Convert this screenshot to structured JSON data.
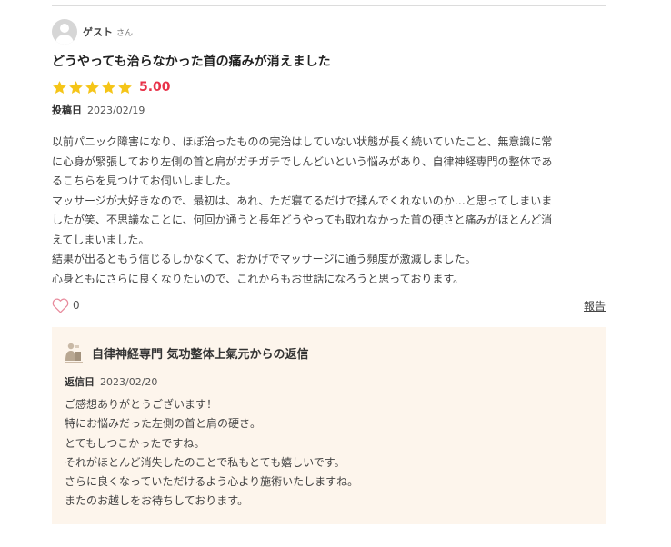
{
  "reviewer": {
    "name": "ゲスト",
    "suffix": "さん",
    "avatar_icon": "user-avatar-icon"
  },
  "review": {
    "title": "どうやっても治らなかった首の痛みが消えました",
    "rating": {
      "stars": 5,
      "max_stars": 5,
      "value_text": "5.00",
      "star_color": "#f5c518",
      "value_color": "#e8334a"
    },
    "posted_label": "投稿日",
    "posted_date": "2023/02/19",
    "body_lines": [
      "以前パニック障害になり、ほぼ治ったものの完治はしていない状態が長く続いていたこと、無意識に常",
      "に心身が緊張しており左側の首と肩がガチガチでしんどいという悩みがあり、自律神経専門の整体であ",
      "るこちらを見つけてお伺いしました。",
      "マッサージが大好きなので、最初は、あれ、ただ寝てるだけで揉んでくれないのか…と思ってしまいま",
      "したが笑、不思議なことに、何回か通うと長年どうやっても取れなかった首の硬さと痛みがほとんど消",
      "えてしまいました。",
      "結果が出るともう信じるしかなくて、おかげでマッサージに通う頻度が激減しました。",
      "心身ともにさらに良くなりたいので、これからもお世話になろうと思っております。"
    ],
    "likes": {
      "count": "0",
      "icon": "heart-icon",
      "color": "#e88a9c"
    },
    "report_label": "報告"
  },
  "reply": {
    "shop_icon": "shop-logo-icon",
    "title": "自律神経専門 気功整体上氣元からの返信",
    "date_label": "返信日",
    "date": "2023/02/20",
    "body_lines": [
      "ご感想ありがとうございます！",
      "特にお悩みだった左側の首と肩の硬さ。",
      "とてもしつこかったですね。",
      "それがほとんど消失したのことで私もとても嬉しいです。",
      "さらに良くなっていただけるよう心より施術いたしますね。",
      "またのお越しをお待ちしております。"
    ],
    "background_color": "#fdf5ec"
  }
}
